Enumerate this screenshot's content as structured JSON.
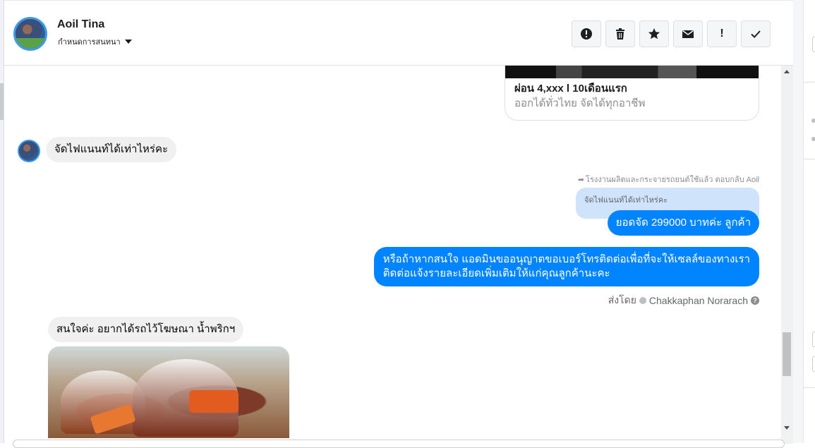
{
  "header": {
    "name": "Aoil Tina",
    "subtitle": "กำหนดการสนทนา"
  },
  "toolbar": {
    "buttons": [
      {
        "icon": "alert-circle-icon"
      },
      {
        "icon": "trash-icon"
      },
      {
        "icon": "star-icon"
      },
      {
        "icon": "envelope-icon"
      },
      {
        "icon": "exclamation-icon",
        "label": "!"
      },
      {
        "icon": "checkmark-icon"
      }
    ]
  },
  "chat": {
    "card": {
      "title": "ผ่อน 4,xxx l 10เดือนแรก",
      "subtitle": "ออกได้ทั่วไทย จัดได้ทุกอาชีพ"
    },
    "incoming_1": "จัดไฟแนนท์ได้เท่าไหร่คะ",
    "reply_meta": "โรงงานผลิตและกระจายรถยนต์ใช้แล้ว ตอบกลับ Aoil",
    "quoted_text": "จัดไฟแนนท์ได้เท่าไหร่คะ",
    "outgoing_1": "ยอดจัด 299000 บาทค่ะ ลูกค้า",
    "outgoing_2_line1": "หรือถ้าหากสนใจ แอดมินขออนุญาตขอเบอร์โทรติดต่อเพื่อที่จะให้เซลล์ของทางเรา",
    "outgoing_2_line2": "ติดต่อแจ้งรายละเอียดเพิ่มเติมให้แก่คุณลูกค้านะคะ",
    "sent_by_label": "ส่งโดย",
    "sent_by_name": "Chakkaphan Norarach",
    "incoming_2": "สนใจค่ะ อยากได้รถไว้โฆษณา น้ำพริกฯ"
  },
  "colors": {
    "accent": "#0084ff",
    "incoming_bubble": "#f0f0f0",
    "quoted_bubble": "#cfe3fb"
  }
}
